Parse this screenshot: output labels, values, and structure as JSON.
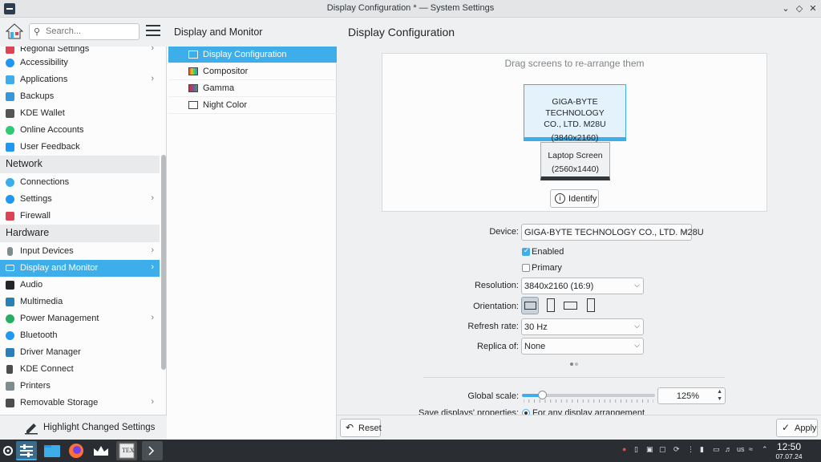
{
  "window": {
    "title": "Display Configuration * — System Settings",
    "controls": [
      "minimize",
      "maximize",
      "close"
    ]
  },
  "search": {
    "placeholder": "Search..."
  },
  "sidebar": {
    "items": [
      {
        "label": "Regional Settings",
        "icon": "flag-icon",
        "color": "#da4453",
        "chevron": true
      },
      {
        "label": "Accessibility",
        "icon": "accessibility-icon",
        "color": "#1d99f3",
        "chevron": false
      },
      {
        "label": "Applications",
        "icon": "applications-icon",
        "color": "#3daee9",
        "chevron": true
      },
      {
        "label": "Backups",
        "icon": "backups-icon",
        "color": "#3498db",
        "chevron": false
      },
      {
        "label": "KDE Wallet",
        "icon": "wallet-icon",
        "color": "#555555",
        "chevron": false
      },
      {
        "label": "Online Accounts",
        "icon": "online-accounts-icon",
        "color": "#2ecc71",
        "chevron": false
      },
      {
        "label": "User Feedback",
        "icon": "feedback-icon",
        "color": "#1d99f3",
        "chevron": false
      }
    ],
    "network_title": "Network",
    "network_items": [
      {
        "label": "Connections",
        "icon": "globe-icon",
        "color": "#3daee9",
        "chevron": false
      },
      {
        "label": "Settings",
        "icon": "network-settings-icon",
        "color": "#1d99f3",
        "chevron": true
      },
      {
        "label": "Firewall",
        "icon": "firewall-icon",
        "color": "#da4453",
        "chevron": false
      }
    ],
    "hardware_title": "Hardware",
    "hardware_items": [
      {
        "label": "Input Devices",
        "icon": "mouse-icon",
        "color": "#7f8c8d",
        "chevron": true
      },
      {
        "label": "Display and Monitor",
        "icon": "monitor-icon",
        "color": "#ffffff",
        "chevron": true,
        "selected": true
      },
      {
        "label": "Audio",
        "icon": "audio-icon",
        "color": "#232629",
        "chevron": false
      },
      {
        "label": "Multimedia",
        "icon": "multimedia-icon",
        "color": "#2980b9",
        "chevron": false
      },
      {
        "label": "Power Management",
        "icon": "power-icon",
        "color": "#27ae60",
        "chevron": true
      },
      {
        "label": "Bluetooth",
        "icon": "bluetooth-icon",
        "color": "#1d99f3",
        "chevron": false
      },
      {
        "label": "Driver Manager",
        "icon": "driver-icon",
        "color": "#2980b9",
        "chevron": false
      },
      {
        "label": "KDE Connect",
        "icon": "kde-connect-icon",
        "color": "#4d4d4d",
        "chevron": false
      },
      {
        "label": "Printers",
        "icon": "printer-icon",
        "color": "#7f8c8d",
        "chevron": false
      },
      {
        "label": "Removable Storage",
        "icon": "storage-icon",
        "color": "#4d4d4d",
        "chevron": true
      }
    ],
    "highlight_label": "Highlight Changed Settings"
  },
  "middle": {
    "title": "Display and Monitor",
    "items": [
      {
        "label": "Display Configuration",
        "selected": true
      },
      {
        "label": "Compositor",
        "selected": false
      },
      {
        "label": "Gamma",
        "selected": false
      },
      {
        "label": "Night Color",
        "selected": false
      }
    ]
  },
  "main": {
    "title": "Display Configuration",
    "hint": "Drag screens to re-arrange them",
    "screens": [
      {
        "name": "GIGA-BYTE TECHNOLOGY CO., LTD. M28U",
        "line1": "GIGA-BYTE TECHNOLOGY",
        "line2": "CO., LTD. M28U",
        "res": "(3840x2160)"
      },
      {
        "name": "Laptop Screen",
        "res": "(2560x1440)"
      }
    ],
    "identify_label": "Identify",
    "device_label": "Device:",
    "device_value": "GIGA-BYTE TECHNOLOGY CO., LTD. M28U",
    "enabled_label": "Enabled",
    "enabled": true,
    "primary_label": "Primary",
    "primary": false,
    "resolution_label": "Resolution:",
    "resolution_value": "3840x2160 (16:9)",
    "orientation_label": "Orientation:",
    "refresh_label": "Refresh rate:",
    "refresh_value": "30 Hz",
    "replica_label": "Replica of:",
    "replica_value": "None",
    "scale_label": "Global scale:",
    "scale_value": "125%",
    "scale_fraction": 0.15,
    "save_label": "Save displays' properties:",
    "save_option": "For any display arrangement",
    "reset_label": "Reset",
    "apply_label": "Apply"
  },
  "taskbar": {
    "time": "12:50",
    "date": "07.07.24",
    "keyboard_layout": "us"
  },
  "colors": {
    "accent": "#3daee9",
    "taskbar": "#2a2e32"
  }
}
